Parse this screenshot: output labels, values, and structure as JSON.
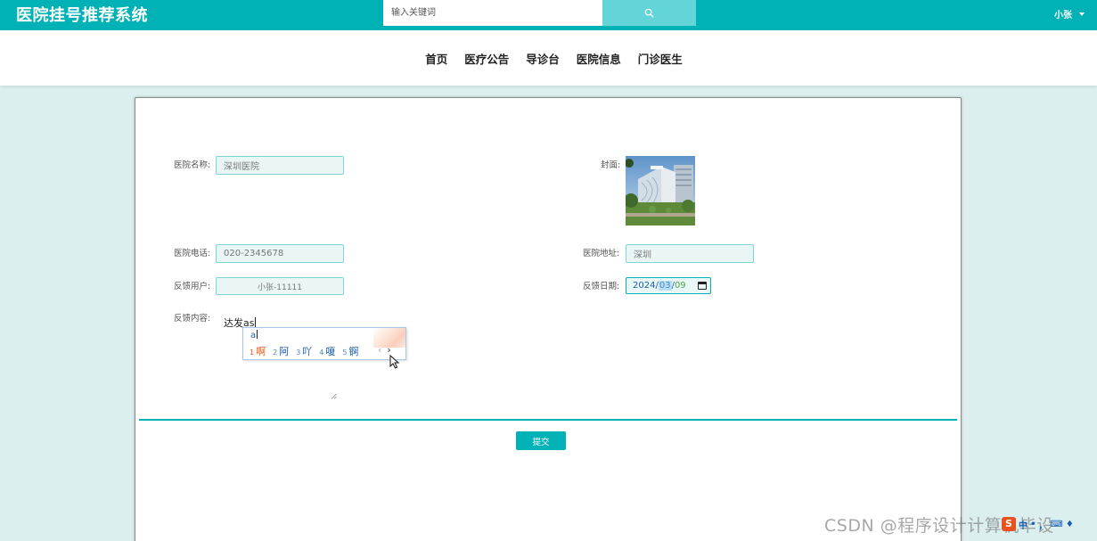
{
  "app": {
    "title": "医院挂号推荐系统"
  },
  "search": {
    "placeholder": "输入关键词"
  },
  "user": {
    "name": "小张"
  },
  "nav": {
    "items": [
      {
        "label": "首页"
      },
      {
        "label": "医疗公告"
      },
      {
        "label": "导诊台"
      },
      {
        "label": "医院信息"
      },
      {
        "label": "门诊医生"
      }
    ]
  },
  "form": {
    "hospital_name": {
      "label": "医院名称:",
      "value": "深圳医院"
    },
    "cover": {
      "label": "封面:"
    },
    "phone": {
      "label": "医院电话:",
      "value": "020-2345678"
    },
    "address": {
      "label": "医院地址:",
      "value": "深圳"
    },
    "feedback_user": {
      "label": "反馈用户:",
      "value": "小张-11111"
    },
    "feedback_date": {
      "label": "反馈日期:",
      "year": "2024",
      "month": "03",
      "day": "09",
      "sep": "/"
    },
    "feedback_content": {
      "label": "反馈内容:",
      "value": "达发as"
    },
    "submit_label": "提交"
  },
  "ime": {
    "composition": "a",
    "candidates": [
      {
        "num": "1",
        "text": "啊"
      },
      {
        "num": "2",
        "text": "阿"
      },
      {
        "num": "3",
        "text": "吖"
      },
      {
        "num": "4",
        "text": "嗄"
      },
      {
        "num": "5",
        "text": "锕"
      }
    ],
    "prev": "‹",
    "next": "›"
  },
  "watermark": {
    "text": "CSDN @程序设计计算机毕设"
  },
  "ime_toolbar": {
    "logo": "S",
    "items": [
      "中",
      "•",
      "，",
      "⌨",
      "♦"
    ]
  },
  "colors": {
    "primary": "#00b2b5",
    "search_button": "#63d4d8",
    "page_bg": "#dcefef"
  },
  "icons": {
    "search": "search-icon",
    "caret": "caret-down-icon",
    "calendar": "calendar-icon"
  }
}
